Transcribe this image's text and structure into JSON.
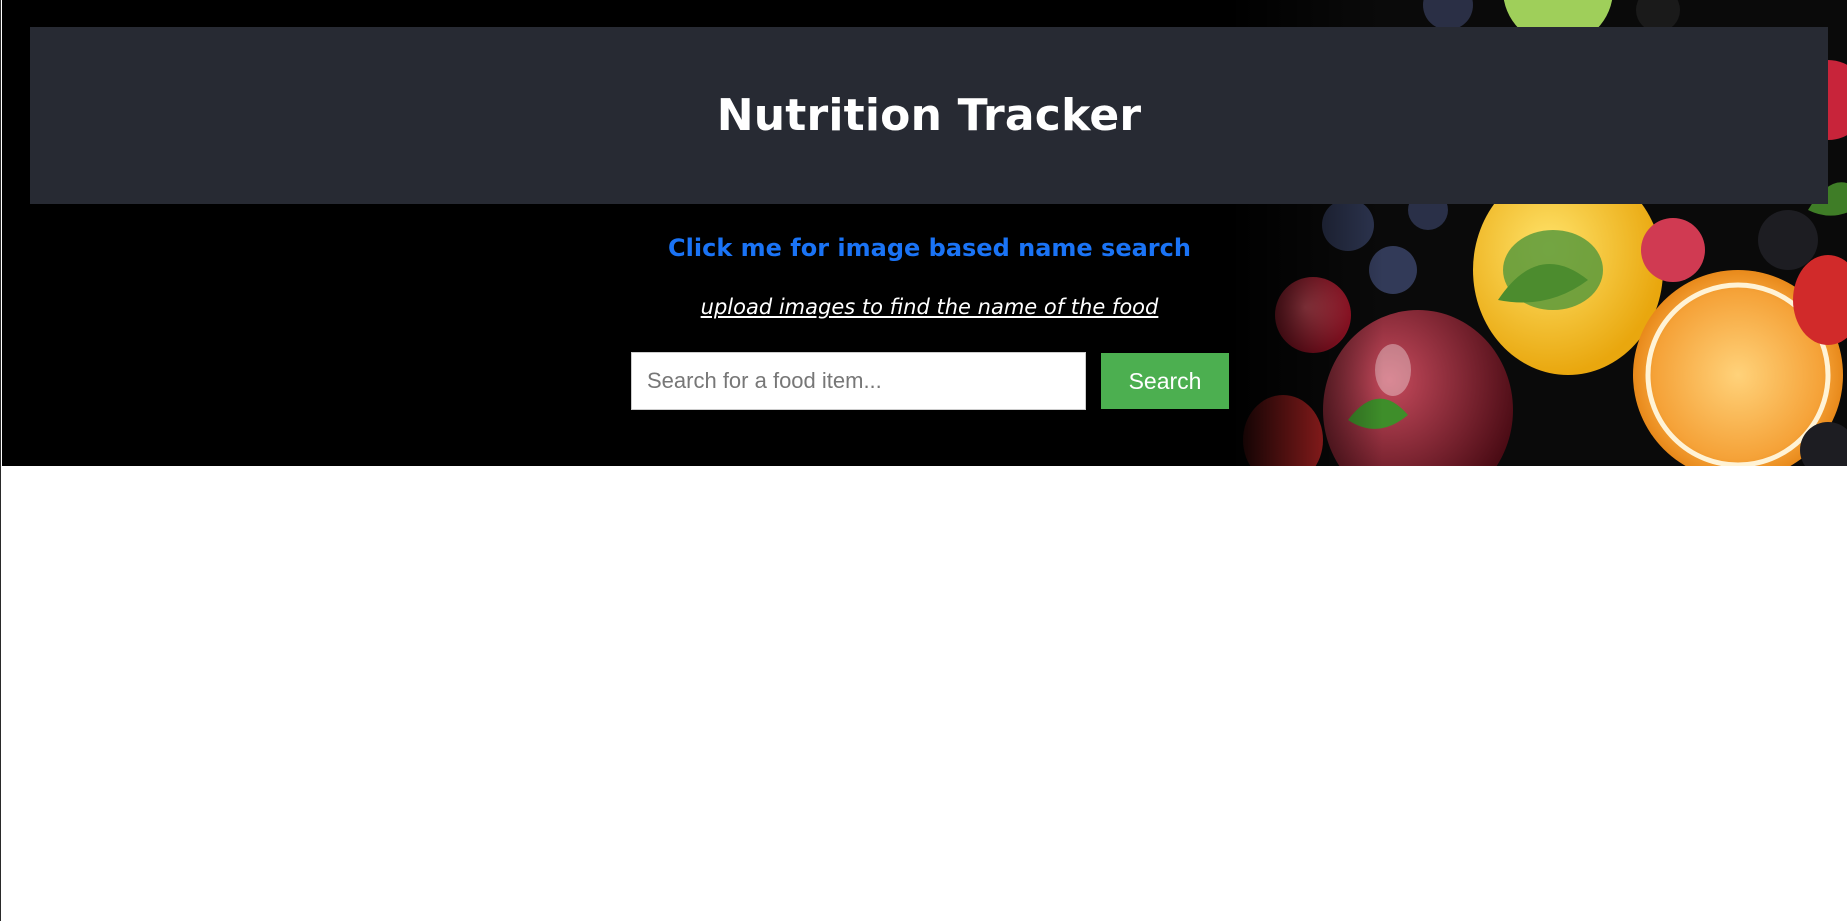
{
  "header": {
    "title": "Nutrition Tracker"
  },
  "links": {
    "image_search": "Click me for image based name search",
    "upload_images": "upload images to find the name of the food"
  },
  "search": {
    "placeholder": "Search for a food item...",
    "value": "",
    "button_label": "Search"
  },
  "colors": {
    "header_bg": "#272a33",
    "hero_bg": "#000000",
    "link_blue": "#1a73f5",
    "button_green": "#4caf50"
  },
  "background_image": {
    "icon": "fruit-collage-image"
  }
}
